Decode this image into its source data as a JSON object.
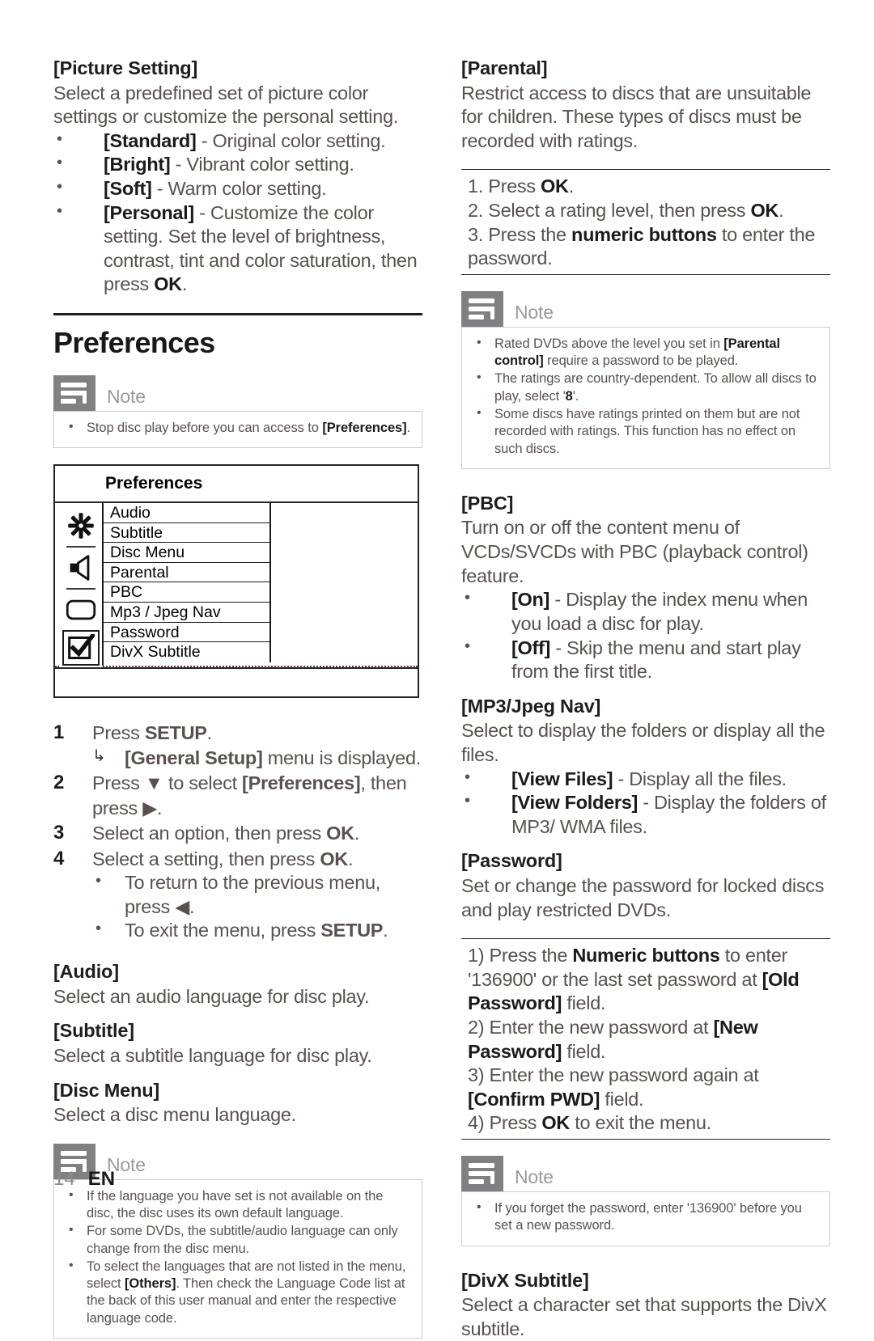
{
  "document": {
    "footer": {
      "page_number": "14",
      "language_code": "EN"
    }
  },
  "left_column": {
    "picture_setting": {
      "heading": "[Picture Setting]",
      "intro": "Select a predefined set of picture color settings or customize the personal setting.",
      "options": [
        {
          "term": "[Standard]",
          "desc": " - Original color setting."
        },
        {
          "term": "[Bright]",
          "desc": " - Vibrant color setting."
        },
        {
          "term": "[Soft]",
          "desc": " - Warm color setting."
        },
        {
          "term": "[Personal]",
          "desc": " - Customize the color setting. Set the level of brightness, contrast, tint and color saturation, then press ",
          "desc_bold": "OK",
          "desc_tail": "."
        }
      ]
    },
    "preferences_section": {
      "heading": "Preferences",
      "note": {
        "title": "Note",
        "items": [
          {
            "pre": "Stop disc play before you can access to ",
            "bold": "[Preferences]",
            "post": "."
          }
        ]
      },
      "screenshot": {
        "title": "Preferences",
        "icons": [
          {
            "name": "gear-icon",
            "selected": false
          },
          {
            "name": "speaker-icon",
            "selected": false
          },
          {
            "name": "video-screen-icon",
            "selected": false
          },
          {
            "name": "checkbox-check-icon",
            "selected": true
          }
        ],
        "rows": [
          "Audio",
          "Subtitle",
          "Disc Menu",
          "Parental",
          "PBC",
          "Mp3 / Jpeg Nav",
          "Password",
          "DivX Subtitle"
        ]
      },
      "steps": [
        {
          "num": "1",
          "text_pre": "Press ",
          "bold": "SETUP",
          "text_post": ".",
          "substep": {
            "arrow": "↳",
            "bold": "[General Setup]",
            "post": " menu is displayed."
          }
        },
        {
          "num": "2",
          "text_pre": "Press ▼ to select ",
          "bold": "[Preferences]",
          "text_post": ", then press ▶."
        },
        {
          "num": "3",
          "text_pre": "Select an option, then press ",
          "bold": "OK",
          "text_post": "."
        },
        {
          "num": "4",
          "text_pre": "Select a setting, then press ",
          "bold": "OK",
          "text_post": "."
        }
      ],
      "step_bullets": [
        {
          "pre": "To return to the previous menu, press ◀.",
          "bold": "",
          "post": ""
        },
        {
          "pre": "To exit the menu, press ",
          "bold": "SETUP",
          "post": "."
        }
      ]
    },
    "audio": {
      "heading": "[Audio]",
      "body": "Select an audio language for disc play."
    },
    "subtitle": {
      "heading": "[Subtitle]",
      "body": "Select a subtitle language for disc play."
    },
    "disc_menu": {
      "heading": "[Disc Menu]",
      "body": "Select a disc menu language."
    },
    "language_note": {
      "title": "Note",
      "items": [
        {
          "pre": "If the language you have set is not available on the disc, the disc uses its own default language.",
          "bold": "",
          "post": ""
        },
        {
          "pre": "For some DVDs, the subtitle/audio language can only change from the disc menu.",
          "bold": "",
          "post": ""
        },
        {
          "pre": "To select the languages that are not listed in the menu, select ",
          "bold": "[Others]",
          "post": ". Then check the Language Code list at the back of this user manual and enter the respective language code."
        }
      ]
    }
  },
  "right_column": {
    "parental": {
      "heading": "[Parental]",
      "body": "Restrict access to discs that are unsuitable for children. These types of discs must be recorded with ratings.",
      "steps": [
        {
          "pre": "1. Press ",
          "bold": "OK",
          "post": "."
        },
        {
          "pre": "2. Select a rating level, then press ",
          "bold": "OK",
          "post": "."
        },
        {
          "pre": "3. Press the ",
          "bold": "numeric buttons",
          "post": " to enter the password."
        }
      ]
    },
    "parental_note": {
      "title": "Note",
      "items": [
        {
          "pre": "Rated DVDs above the level you set in ",
          "bold": "[Parental control]",
          "post": " require a password to be played."
        },
        {
          "pre": "The ratings are country-dependent. To allow all discs to play, select '",
          "bold": "8",
          "post": "'."
        },
        {
          "pre": "Some discs have ratings printed on them but are not recorded with ratings. This function has no effect on such discs.",
          "bold": "",
          "post": ""
        }
      ]
    },
    "pbc": {
      "heading": "[PBC]",
      "body": "Turn on or off the content menu of VCDs/SVCDs with PBC (playback control) feature.",
      "options": [
        {
          "term": "[On]",
          "desc": " - Display the index menu when you load a disc for play."
        },
        {
          "term": "[Off]",
          "desc": " - Skip the menu and start play from the first title."
        }
      ]
    },
    "mp3_jpeg_nav": {
      "heading": "[MP3/Jpeg Nav]",
      "body": "Select to display the folders or display all the files.",
      "options": [
        {
          "term": "[View Files]",
          "desc": " - Display all the files."
        },
        {
          "term": "[View Folders]",
          "desc": " - Display the folders of MP3/ WMA files."
        }
      ]
    },
    "password": {
      "heading": "[Password]",
      "body": "Set or change the password for locked discs and play restricted DVDs.",
      "steps": [
        {
          "pre": "1) Press the ",
          "bold": "Numeric buttons",
          "mid": " to enter '136900' or the last set password at ",
          "bold2": "[Old Password]",
          "post": " field."
        },
        {
          "pre": "2) Enter the new password at ",
          "bold": "[New Password]",
          "post": " field."
        },
        {
          "pre": "3) Enter the new password again at ",
          "bold": "[Confirm PWD]",
          "post": " field."
        },
        {
          "pre": "4) Press ",
          "bold": "OK",
          "post": " to exit the menu."
        }
      ]
    },
    "password_note": {
      "title": "Note",
      "items": [
        {
          "pre": "If you forget the password, enter '136900' before you set a new password.",
          "bold": "",
          "post": ""
        }
      ]
    },
    "divx_subtitle": {
      "heading": "[DivX Subtitle]",
      "body": "Select a character set that supports the DivX subtitle."
    }
  }
}
